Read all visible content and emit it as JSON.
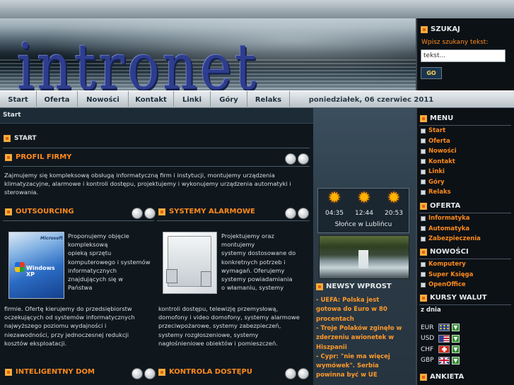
{
  "header": {
    "logo": "intronet"
  },
  "search": {
    "title": "SZUKAJ",
    "label": "Wpisz szukany tekst:",
    "value": "tekst...",
    "go_label": "GO"
  },
  "nav": {
    "items": [
      "Start",
      "Oferta",
      "Nowości",
      "Kontakt",
      "Linki",
      "Góry",
      "Relaks"
    ],
    "date": "poniedziałek, 06 czerwiec 2011"
  },
  "main": {
    "breadcrumb": "Start",
    "start_title": "START",
    "profil": {
      "title": "PROFIL FIRMY",
      "text": "Zajmujemy się kompleksową obsługą informatyczną firm i instytucji, montujemy urządzenia klimatyzacyjne, alarmowe i kontroli dostępu, projektujemy i wykonujemy urządzenia automatyki i sterowania."
    },
    "outsourcing": {
      "title": "OUTSOURCING",
      "image": {
        "brand": "Microsoft",
        "product": "Windows XP"
      },
      "text_lines": [
        "Proponujemy objęcie",
        "kompleksową",
        "opieką sprzętu",
        "komputerowego i systemów",
        "informatycznych",
        "znajdujących się w",
        "Państwa"
      ],
      "text_rest": [
        "firmie. Ofertę kierujemy do przedsiębiorstw",
        "oczekujących od systemów informatycznych",
        "najwyższego poziomu wydajności i",
        "niezawodności, przy jednoczesnej redukcji",
        "kosztów eksploatacji."
      ]
    },
    "alarmowe": {
      "title": "SYSTEMY ALARMOWE",
      "text_lines": [
        "Projektujemy oraz",
        "montujemy",
        "systemy dostosowane do",
        "konkretnych potrzeb i",
        "wymagań. Oferujemy",
        "systemy powiadamiania",
        "o włamaniu, systemy"
      ],
      "text_rest": [
        "kontroli dostępu, telewizję przemysłową,",
        "domofony i video domofony, systemy alarmowe",
        "przeciwpożarowe, systemy zabezpieczeń,",
        "systemy rozgłoszeniowe, systemy",
        "nagłośnieniowe obiektów i pomieszczeń."
      ]
    },
    "dom": {
      "title": "INTELIGENTNY DOM"
    },
    "kontrola": {
      "title": "KONTROLA DOSTĘPU"
    }
  },
  "sun": {
    "times": [
      "04:35",
      "12:44",
      "20:53"
    ],
    "label": "Słońce w Lublińcu"
  },
  "news": {
    "title": "NEWSY WPROST",
    "lines": [
      "-  UEFA: Polska jest",
      "gotowa do Euro w 80",
      "procentach",
      "-  Troje Polaków zginęło w",
      "zderzeniu awionetek w",
      "Hiszpanii",
      "-  Cypr: \"nie ma więcej",
      "wymówek\". Serbia",
      "powinna być w UE"
    ]
  },
  "sidebar": {
    "menu_title": "MENU",
    "menu_items": [
      "Start",
      "Oferta",
      "Nowości",
      "Kontakt",
      "Linki",
      "Góry",
      "Relaks"
    ],
    "oferta_title": "OFERTA",
    "oferta_items": [
      "Informatyka",
      "Automatyka",
      "Zabezpieczenia"
    ],
    "nowosci_title": "NOWOŚCI",
    "nowosci_items": [
      "Komputery",
      "Super Księga",
      "OpenOffice"
    ],
    "kursy_title": "KURSY WALUT",
    "kursy_subtitle": "z dnia",
    "currencies": [
      {
        "code": "EUR",
        "flag": "eu-flag-icon"
      },
      {
        "code": "USD",
        "flag": "us-flag-icon"
      },
      {
        "code": "CHF",
        "flag": "ch-flag-icon"
      },
      {
        "code": "GBP",
        "flag": "gb-flag-icon"
      }
    ],
    "ankieta_title": "ANKIETA"
  },
  "colors": {
    "accent_orange": "#ff8a1c",
    "nav_bg": "#cfd6da",
    "dark_bg": "#0f171d"
  }
}
